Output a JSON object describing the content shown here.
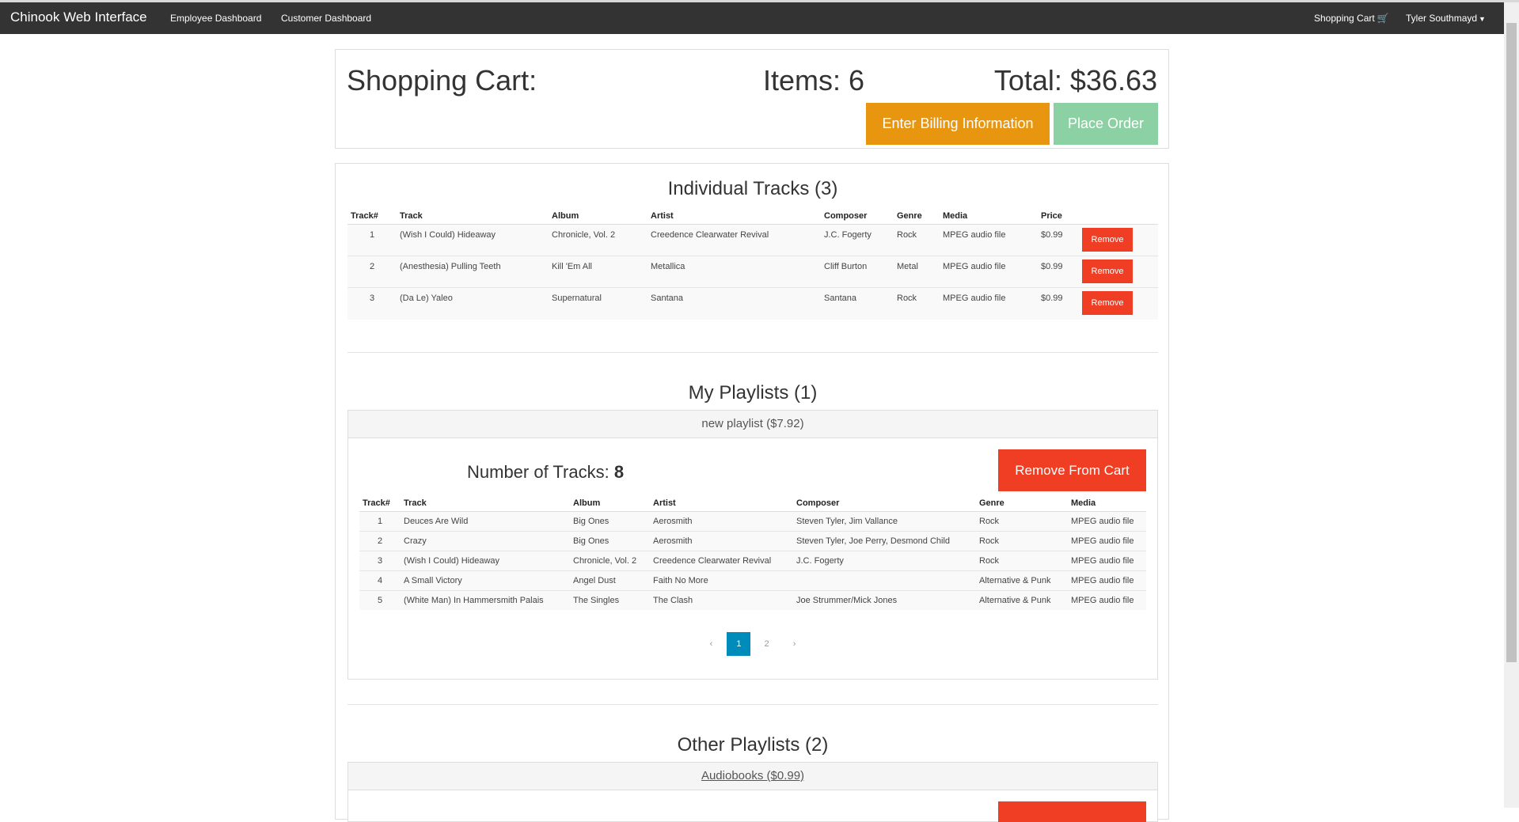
{
  "navbar": {
    "brand": "Chinook Web Interface",
    "links": [
      "Employee Dashboard",
      "Customer Dashboard"
    ],
    "cart": "Shopping Cart",
    "user": "Tyler Southmayd"
  },
  "summary": {
    "title": "Shopping Cart:",
    "items": "Items: 6",
    "total": "Total: $36.63",
    "billing_label": "Enter Billing Information",
    "place_order_label": "Place Order"
  },
  "individual": {
    "title": "Individual Tracks (3)",
    "headers": [
      "Track#",
      "Track",
      "Album",
      "Artist",
      "Composer",
      "Genre",
      "Media",
      "Price"
    ],
    "remove_label": "Remove",
    "rows": [
      [
        "1",
        "(Wish I Could) Hideaway",
        "Chronicle, Vol. 2",
        "Creedence Clearwater Revival",
        "J.C. Fogerty",
        "Rock",
        "MPEG audio file",
        "$0.99"
      ],
      [
        "2",
        "(Anesthesia) Pulling Teeth",
        "Kill 'Em All",
        "Metallica",
        "Cliff Burton",
        "Metal",
        "MPEG audio file",
        "$0.99"
      ],
      [
        "3",
        "(Da Le) Yaleo",
        "Supernatural",
        "Santana",
        "Santana",
        "Rock",
        "MPEG audio file",
        "$0.99"
      ]
    ]
  },
  "my_playlists": {
    "title": "My Playlists (1)",
    "playlist_name": "new playlist ($7.92)",
    "num_tracks_label": "Number of Tracks:",
    "num_tracks_value": "8",
    "remove_label": "Remove From Cart",
    "headers": [
      "Track#",
      "Track",
      "Album",
      "Artist",
      "Composer",
      "Genre",
      "Media"
    ],
    "rows": [
      [
        "1",
        "Deuces Are Wild",
        "Big Ones",
        "Aerosmith",
        "Steven Tyler, Jim Vallance",
        "Rock",
        "MPEG audio file"
      ],
      [
        "2",
        "Crazy",
        "Big Ones",
        "Aerosmith",
        "Steven Tyler, Joe Perry, Desmond Child",
        "Rock",
        "MPEG audio file"
      ],
      [
        "3",
        "(Wish I Could) Hideaway",
        "Chronicle, Vol. 2",
        "Creedence Clearwater Revival",
        "J.C. Fogerty",
        "Rock",
        "MPEG audio file"
      ],
      [
        "4",
        "A Small Victory",
        "Angel Dust",
        "Faith No More",
        "",
        "Alternative & Punk",
        "MPEG audio file"
      ],
      [
        "5",
        "(White Man) In Hammersmith Palais",
        "The Singles",
        "The Clash",
        "Joe Strummer/Mick Jones",
        "Alternative & Punk",
        "MPEG audio file"
      ]
    ],
    "pagination": {
      "prev": "‹",
      "pages": [
        "1",
        "2"
      ],
      "next": "›",
      "active": "1"
    }
  },
  "other_playlists": {
    "title": "Other Playlists (2)",
    "first_name": "Audiobooks ($0.99)"
  }
}
